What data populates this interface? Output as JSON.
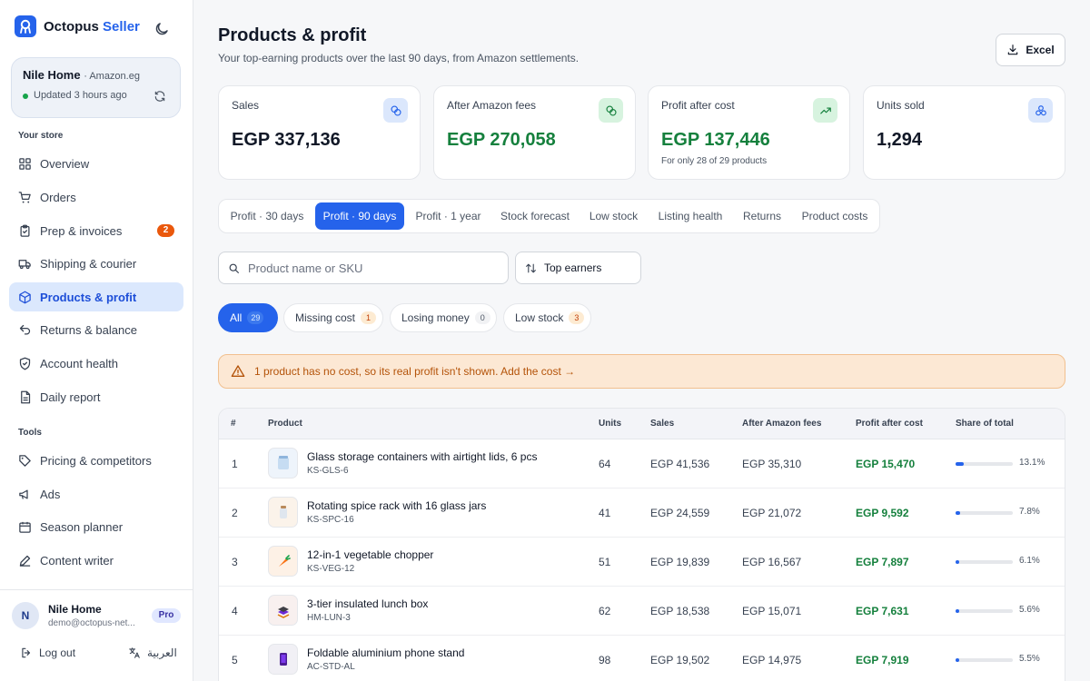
{
  "brand": {
    "name_primary": "Octopus",
    "name_accent": "Seller"
  },
  "store": {
    "name": "Nile Home",
    "marketplace": "· Amazon.eg",
    "status": "Updated 3 hours ago"
  },
  "sidebar": {
    "section_store": "Your store",
    "section_tools": "Tools",
    "items": [
      {
        "label": "Overview",
        "icon": "grid-icon"
      },
      {
        "label": "Orders",
        "icon": "cart-icon"
      },
      {
        "label": "Prep & invoices",
        "icon": "clipboard-icon",
        "badge": "2"
      },
      {
        "label": "Shipping & courier",
        "icon": "truck-icon"
      },
      {
        "label": "Products & profit",
        "icon": "box-icon",
        "active": true
      },
      {
        "label": "Returns & balance",
        "icon": "return-icon"
      },
      {
        "label": "Account health",
        "icon": "shield-icon"
      },
      {
        "label": "Daily report",
        "icon": "document-icon"
      }
    ],
    "tools": [
      {
        "label": "Pricing & competitors",
        "icon": "tag-icon"
      },
      {
        "label": "Ads",
        "icon": "megaphone-icon"
      },
      {
        "label": "Season planner",
        "icon": "calendar-icon"
      },
      {
        "label": "Content writer",
        "icon": "pen-icon"
      }
    ]
  },
  "user": {
    "initial": "N",
    "name": "Nile Home",
    "email": "demo@octopus-net...",
    "plan": "Pro",
    "logout": "Log out",
    "language": "العربية"
  },
  "page": {
    "title": "Products & profit",
    "subtitle": "Your top-earning products over the last 90 days, from Amazon settlements.",
    "export_label": "Excel"
  },
  "kpis": [
    {
      "label": "Sales",
      "value": "EGP 337,136",
      "icon": "coins-icon"
    },
    {
      "label": "After Amazon fees",
      "value": "EGP 270,058",
      "icon": "coins-icon"
    },
    {
      "label": "Profit after cost",
      "value": "EGP 137,446",
      "note": "For only 28 of 29 products",
      "icon": "trend-up-icon"
    },
    {
      "label": "Units sold",
      "value": "1,294",
      "icon": "cubes-icon"
    }
  ],
  "tabs": [
    "Profit · 30 days",
    "Profit · 90 days",
    "Profit · 1 year",
    "Stock forecast",
    "Low stock",
    "Listing health",
    "Returns",
    "Product costs"
  ],
  "active_tab": "Profit · 90 days",
  "search": {
    "placeholder": "Product name or SKU"
  },
  "sort": {
    "label": "Top earners"
  },
  "filters": [
    {
      "label": "All",
      "count": "29"
    },
    {
      "label": "Missing cost",
      "count": "1"
    },
    {
      "label": "Losing money",
      "count": "0"
    },
    {
      "label": "Low stock",
      "count": "3"
    }
  ],
  "alert": {
    "text": "1 product has no cost, so its real profit isn't shown. Add the cost →"
  },
  "table": {
    "headers": [
      "#",
      "Product",
      "Units",
      "Sales",
      "After Amazon fees",
      "Profit after cost",
      "Share of total"
    ],
    "rows": [
      {
        "rank": "1",
        "name": "Glass storage containers with airtight lids, 6 pcs",
        "sku": "KS-GLS-6",
        "units": "64",
        "sales": "EGP 41,536",
        "after_fees": "EGP 35,310",
        "profit": "EGP 15,470",
        "share": "13.1%",
        "share_value": 13.1
      },
      {
        "rank": "2",
        "name": "Rotating spice rack with 16 glass jars",
        "sku": "KS-SPC-16",
        "units": "41",
        "sales": "EGP 24,559",
        "after_fees": "EGP 21,072",
        "profit": "EGP 9,592",
        "share": "7.8%",
        "share_value": 7.8
      },
      {
        "rank": "3",
        "name": "12-in-1 vegetable chopper",
        "sku": "KS-VEG-12",
        "units": "51",
        "sales": "EGP 19,839",
        "after_fees": "EGP 16,567",
        "profit": "EGP 7,897",
        "share": "6.1%",
        "share_value": 6.1
      },
      {
        "rank": "4",
        "name": "3-tier insulated lunch box",
        "sku": "HM-LUN-3",
        "units": "62",
        "sales": "EGP 18,538",
        "after_fees": "EGP 15,071",
        "profit": "EGP 7,631",
        "share": "5.6%",
        "share_value": 5.6
      },
      {
        "rank": "5",
        "name": "Foldable aluminium phone stand",
        "sku": "AC-STD-AL",
        "units": "98",
        "sales": "EGP 19,502",
        "after_fees": "EGP 14,975",
        "profit": "EGP 7,919",
        "share": "5.5%",
        "share_value": 5.5
      }
    ]
  },
  "colors": {
    "accent": "#2563eb",
    "profit": "#15803d",
    "warning": "#b45309",
    "badge": "#ea580c"
  }
}
